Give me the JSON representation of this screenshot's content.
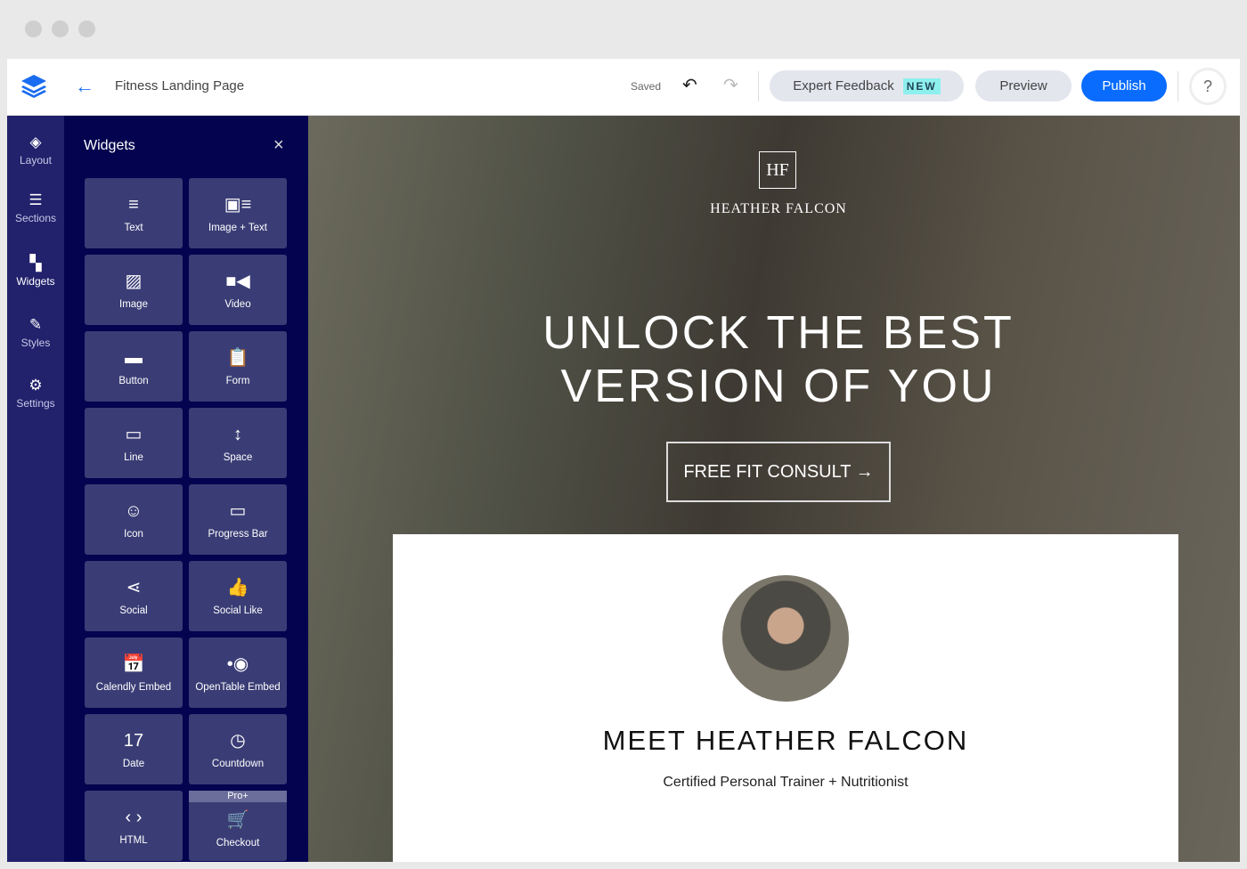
{
  "header": {
    "title": "Fitness Landing Page",
    "saved": "Saved",
    "expert_feedback": "Expert Feedback",
    "new_badge": "NEW",
    "preview": "Preview",
    "publish": "Publish",
    "help": "?"
  },
  "rail": [
    {
      "label": "Layout",
      "icon": "layers-icon"
    },
    {
      "label": "Sections",
      "icon": "sections-icon"
    },
    {
      "label": "Widgets",
      "icon": "widgets-icon"
    },
    {
      "label": "Styles",
      "icon": "brush-icon"
    },
    {
      "label": "Settings",
      "icon": "gear-icon"
    }
  ],
  "panel": {
    "title": "Widgets",
    "close": "×",
    "pro_badge": "Pro+",
    "widgets": [
      {
        "label": "Text",
        "icon": "≡"
      },
      {
        "label": "Image + Text",
        "icon": "▣≡"
      },
      {
        "label": "Image",
        "icon": "▨"
      },
      {
        "label": "Video",
        "icon": "■◀"
      },
      {
        "label": "Button",
        "icon": "▬"
      },
      {
        "label": "Form",
        "icon": "📋"
      },
      {
        "label": "Line",
        "icon": "▭"
      },
      {
        "label": "Space",
        "icon": "↕"
      },
      {
        "label": "Icon",
        "icon": "☺"
      },
      {
        "label": "Progress Bar",
        "icon": "▭"
      },
      {
        "label": "Social",
        "icon": "⋖"
      },
      {
        "label": "Social Like",
        "icon": "👍"
      },
      {
        "label": "Calendly Embed",
        "icon": "📅"
      },
      {
        "label": "OpenTable Embed",
        "icon": "•◉"
      },
      {
        "label": "Date",
        "icon": "17"
      },
      {
        "label": "Countdown",
        "icon": "◷"
      },
      {
        "label": "HTML",
        "icon": "‹ ›"
      },
      {
        "label": "Checkout",
        "icon": "🛒"
      }
    ]
  },
  "page": {
    "logo_mark": "HF",
    "brand": "HEATHER FALCON",
    "headline_1": "UNLOCK THE BEST",
    "headline_2": "VERSION OF YOU",
    "cta": "FREE FIT CONSULT →",
    "meet": "MEET HEATHER FALCON",
    "subtitle": "Certified Personal Trainer + Nutritionist"
  },
  "colors": {
    "accent": "#0a6cff",
    "rail": "#21216c",
    "panel": "#03034f",
    "tile": "#3a3d75",
    "new_badge": "#8ef0ee"
  }
}
